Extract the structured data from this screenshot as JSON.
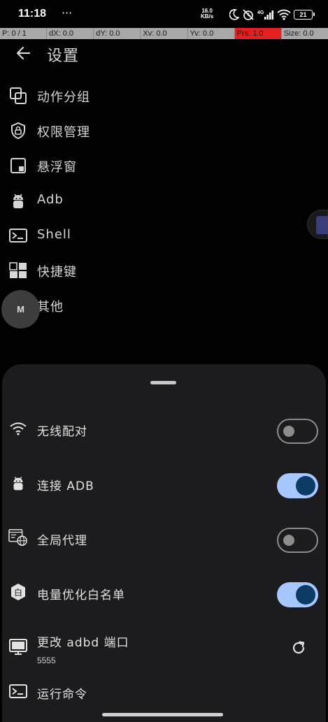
{
  "status_bar": {
    "time": "11:18",
    "dots": "···",
    "net_speed_top": "16.0",
    "net_speed_bottom": "KB/s",
    "signal_label": "4G",
    "battery": "21"
  },
  "pointer_location": {
    "cells": [
      "P: 0 / 1",
      "dX: 0.0",
      "dY: 0.0",
      "Xv: 0.0",
      "Yv: 0.0",
      "Prs: 1.0",
      "Size: 0.0"
    ]
  },
  "header": {
    "title": "设置"
  },
  "menu": {
    "items": [
      {
        "label": "动作分组",
        "icon": "group-icon"
      },
      {
        "label": "权限管理",
        "icon": "shield-lock-icon"
      },
      {
        "label": "悬浮窗",
        "icon": "floating-window-icon"
      },
      {
        "label": "Adb",
        "icon": "android-icon"
      },
      {
        "label": "Shell",
        "icon": "terminal-icon"
      },
      {
        "label": "快捷键",
        "icon": "shortcut-icon"
      },
      {
        "label": "其他",
        "icon": "more-icon"
      }
    ]
  },
  "floating_button": {
    "label": "M"
  },
  "sheet": {
    "items": [
      {
        "label": "无线配对",
        "icon": "wifi-icon",
        "toggle": "off"
      },
      {
        "label": "连接 ADB",
        "icon": "android-icon",
        "toggle": "on"
      },
      {
        "label": "全局代理",
        "icon": "proxy-globe-icon",
        "toggle": "off"
      },
      {
        "label": "电量优化白名单",
        "icon": "whitelist-badge-icon",
        "badge_char": "白",
        "toggle": "on"
      },
      {
        "label": "更改 adbd 端口",
        "sub": "5555",
        "icon": "monitor-icon"
      },
      {
        "label": "运行命令",
        "icon": "terminal-icon"
      }
    ]
  },
  "colors": {
    "toggle_on_track": "#a6c8ff",
    "toggle_on_knob": "#0c3b66",
    "toggle_off": "#8d8d8d",
    "sheet_bg": "#1c1c1e",
    "pressure_highlight": "#e42020"
  }
}
